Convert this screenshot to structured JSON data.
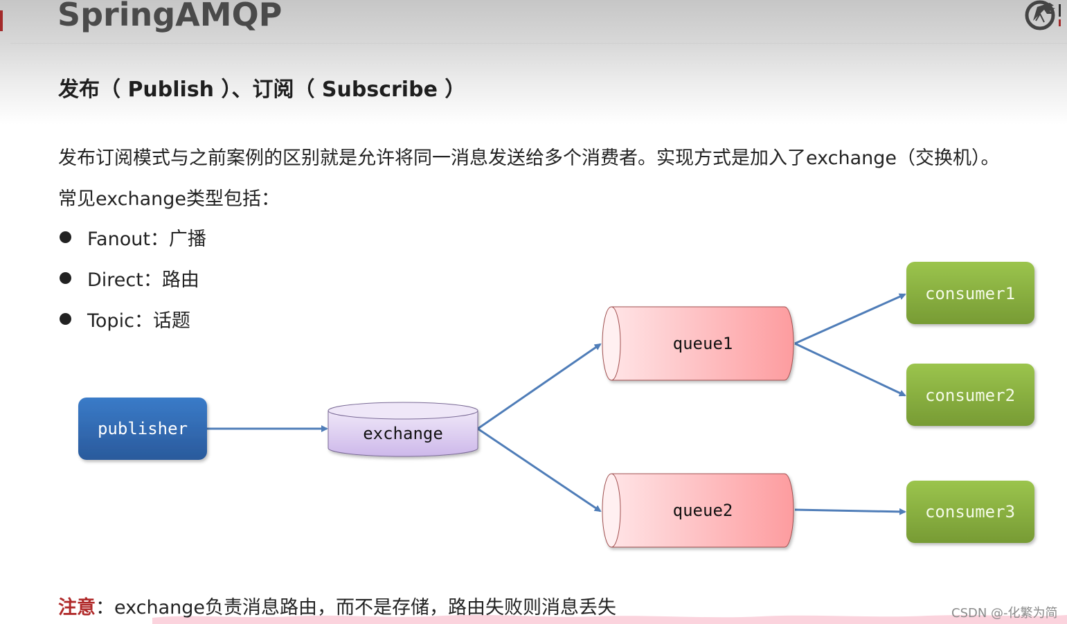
{
  "header": {
    "title": "SpringAMQP",
    "blurred_top_text": "...",
    "logo_icon": "horse-head-logo-icon"
  },
  "subtitle": "发布（ Publish ）、订阅（ Subscribe ）",
  "intro": {
    "line1": "发布订阅模式与之前案例的区别就是允许将同一消息发送给多个消费者。实现方式是加入了exchange（交换机）。",
    "line2": "常见exchange类型包括："
  },
  "exchange_types": [
    {
      "label": "Fanout：广播"
    },
    {
      "label": "Direct：路由"
    },
    {
      "label": "Topic：话题"
    }
  ],
  "diagram": {
    "nodes": {
      "publisher": "publisher",
      "exchange": "exchange",
      "queue1": "queue1",
      "queue2": "queue2",
      "consumer1": "consumer1",
      "consumer2": "consumer2",
      "consumer3": "consumer3"
    },
    "edges": [
      {
        "from": "publisher",
        "to": "exchange"
      },
      {
        "from": "exchange",
        "to": "queue1"
      },
      {
        "from": "exchange",
        "to": "queue2"
      },
      {
        "from": "queue1",
        "to": "consumer1"
      },
      {
        "from": "queue1",
        "to": "consumer2"
      },
      {
        "from": "queue2",
        "to": "consumer3"
      }
    ],
    "colors": {
      "publisher": "#2e65a8",
      "exchange": "#dcd0ef",
      "queue": "#fcaeb1",
      "consumer": "#86ad3e",
      "arrow": "#4f7db8"
    }
  },
  "note": {
    "label": "注意",
    "text": "：exchange负责消息路由，而不是存储，路由失败则消息丢失"
  },
  "watermark": "CSDN @-化繁为简"
}
